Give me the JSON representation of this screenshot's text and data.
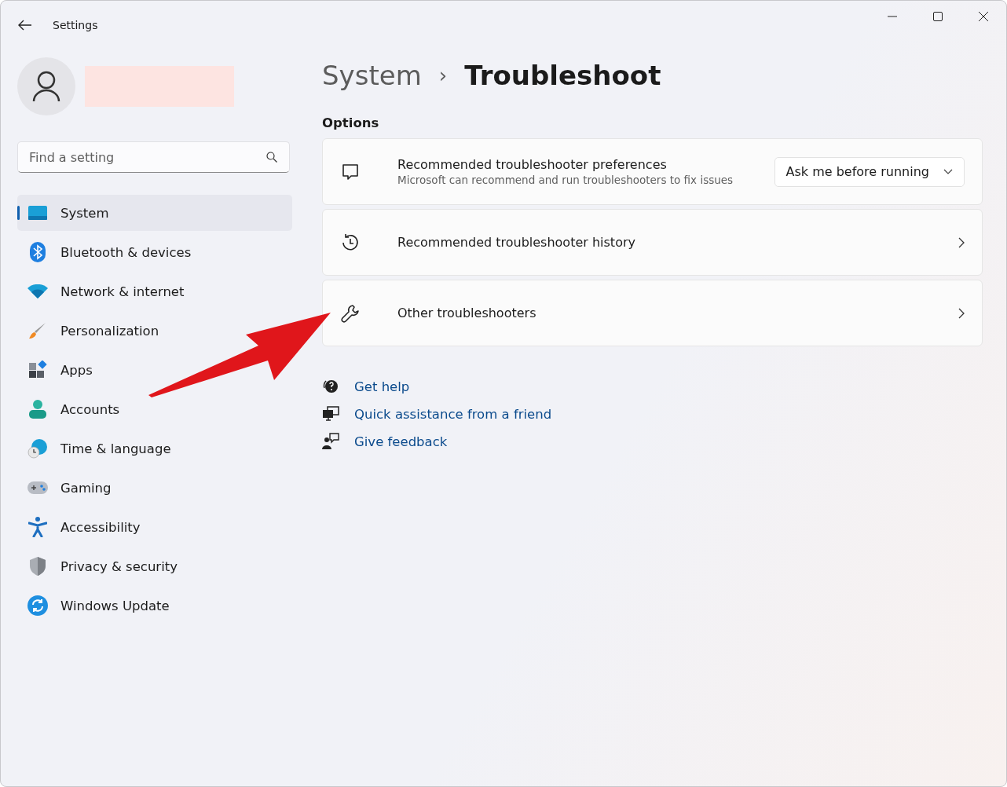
{
  "window": {
    "title": "Settings"
  },
  "search": {
    "placeholder": "Find a setting"
  },
  "sidebar": {
    "items": [
      {
        "label": "System",
        "selected": true
      },
      {
        "label": "Bluetooth & devices",
        "selected": false
      },
      {
        "label": "Network & internet",
        "selected": false
      },
      {
        "label": "Personalization",
        "selected": false
      },
      {
        "label": "Apps",
        "selected": false
      },
      {
        "label": "Accounts",
        "selected": false
      },
      {
        "label": "Time & language",
        "selected": false
      },
      {
        "label": "Gaming",
        "selected": false
      },
      {
        "label": "Accessibility",
        "selected": false
      },
      {
        "label": "Privacy & security",
        "selected": false
      },
      {
        "label": "Windows Update",
        "selected": false
      }
    ]
  },
  "breadcrumb": {
    "parent": "System",
    "separator": "›",
    "current": "Troubleshoot"
  },
  "section": "Options",
  "cards": [
    {
      "kind": "dropdown",
      "title": "Recommended troubleshooter preferences",
      "subtitle": "Microsoft can recommend and run troubleshooters to fix issues",
      "value": "Ask me before running"
    },
    {
      "kind": "link",
      "title": "Recommended troubleshooter history"
    },
    {
      "kind": "link",
      "title": "Other troubleshooters"
    }
  ],
  "help_links": [
    "Get help",
    "Quick assistance from a friend",
    "Give feedback"
  ]
}
